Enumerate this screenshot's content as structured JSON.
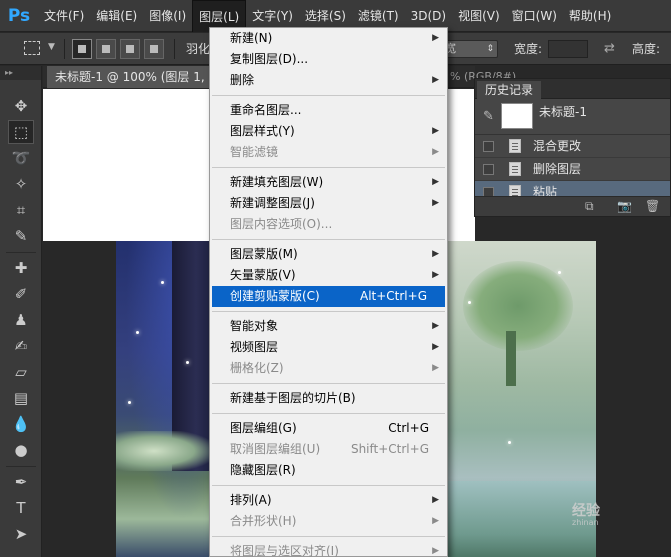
{
  "menubar": {
    "logo": "Ps",
    "items": [
      "文件(F)",
      "编辑(E)",
      "图像(I)",
      "图层(L)",
      "文字(Y)",
      "选择(S)",
      "滤镜(T)",
      "3D(D)",
      "视图(V)",
      "窗口(W)",
      "帮助(H)"
    ],
    "active": "图层(L)"
  },
  "optbar": {
    "feather_label": "羽化",
    "select_fragment": "宽",
    "width_label": "宽度:",
    "height_label": "高度:"
  },
  "document": {
    "tab_title": "未标题-1 @ 100% (图层 1, R",
    "tab_suffix": "% (RGB/8#)"
  },
  "watermark": {
    "text": "经验",
    "url": "zhinan"
  },
  "history": {
    "tab": "历史记录",
    "snapshot_name": "未标题-1",
    "entries": [
      {
        "label": "混合更改",
        "selected": false
      },
      {
        "label": "删除图层",
        "selected": false
      },
      {
        "label": "粘贴",
        "selected": true
      }
    ]
  },
  "layer_menu": {
    "items": [
      {
        "label": "新建(N)",
        "submenu": true
      },
      {
        "label": "复制图层(D)..."
      },
      {
        "label": "删除",
        "submenu": true
      },
      {
        "sep": true
      },
      {
        "label": "重命名图层..."
      },
      {
        "label": "图层样式(Y)",
        "submenu": true
      },
      {
        "label": "智能滤镜",
        "submenu": true,
        "disabled": true
      },
      {
        "sep": true
      },
      {
        "label": "新建填充图层(W)",
        "submenu": true
      },
      {
        "label": "新建调整图层(J)",
        "submenu": true
      },
      {
        "label": "图层内容选项(O)...",
        "disabled": true
      },
      {
        "sep": true
      },
      {
        "label": "图层蒙版(M)",
        "submenu": true
      },
      {
        "label": "矢量蒙版(V)",
        "submenu": true
      },
      {
        "label": "创建剪贴蒙版(C)",
        "shortcut": "Alt+Ctrl+G",
        "highlight": true
      },
      {
        "sep": true
      },
      {
        "label": "智能对象",
        "submenu": true
      },
      {
        "label": "视频图层",
        "submenu": true
      },
      {
        "label": "栅格化(Z)",
        "submenu": true,
        "disabled": true
      },
      {
        "sep": true
      },
      {
        "label": "新建基于图层的切片(B)"
      },
      {
        "sep": true
      },
      {
        "label": "图层编组(G)",
        "shortcut": "Ctrl+G"
      },
      {
        "label": "取消图层编组(U)",
        "shortcut": "Shift+Ctrl+G",
        "disabled": true
      },
      {
        "label": "隐藏图层(R)"
      },
      {
        "sep": true
      },
      {
        "label": "排列(A)",
        "submenu": true
      },
      {
        "label": "合并形状(H)",
        "submenu": true,
        "disabled": true
      },
      {
        "sep": true
      },
      {
        "label": "将图层与选区对齐(I)",
        "submenu": true,
        "disabled": true
      }
    ]
  }
}
